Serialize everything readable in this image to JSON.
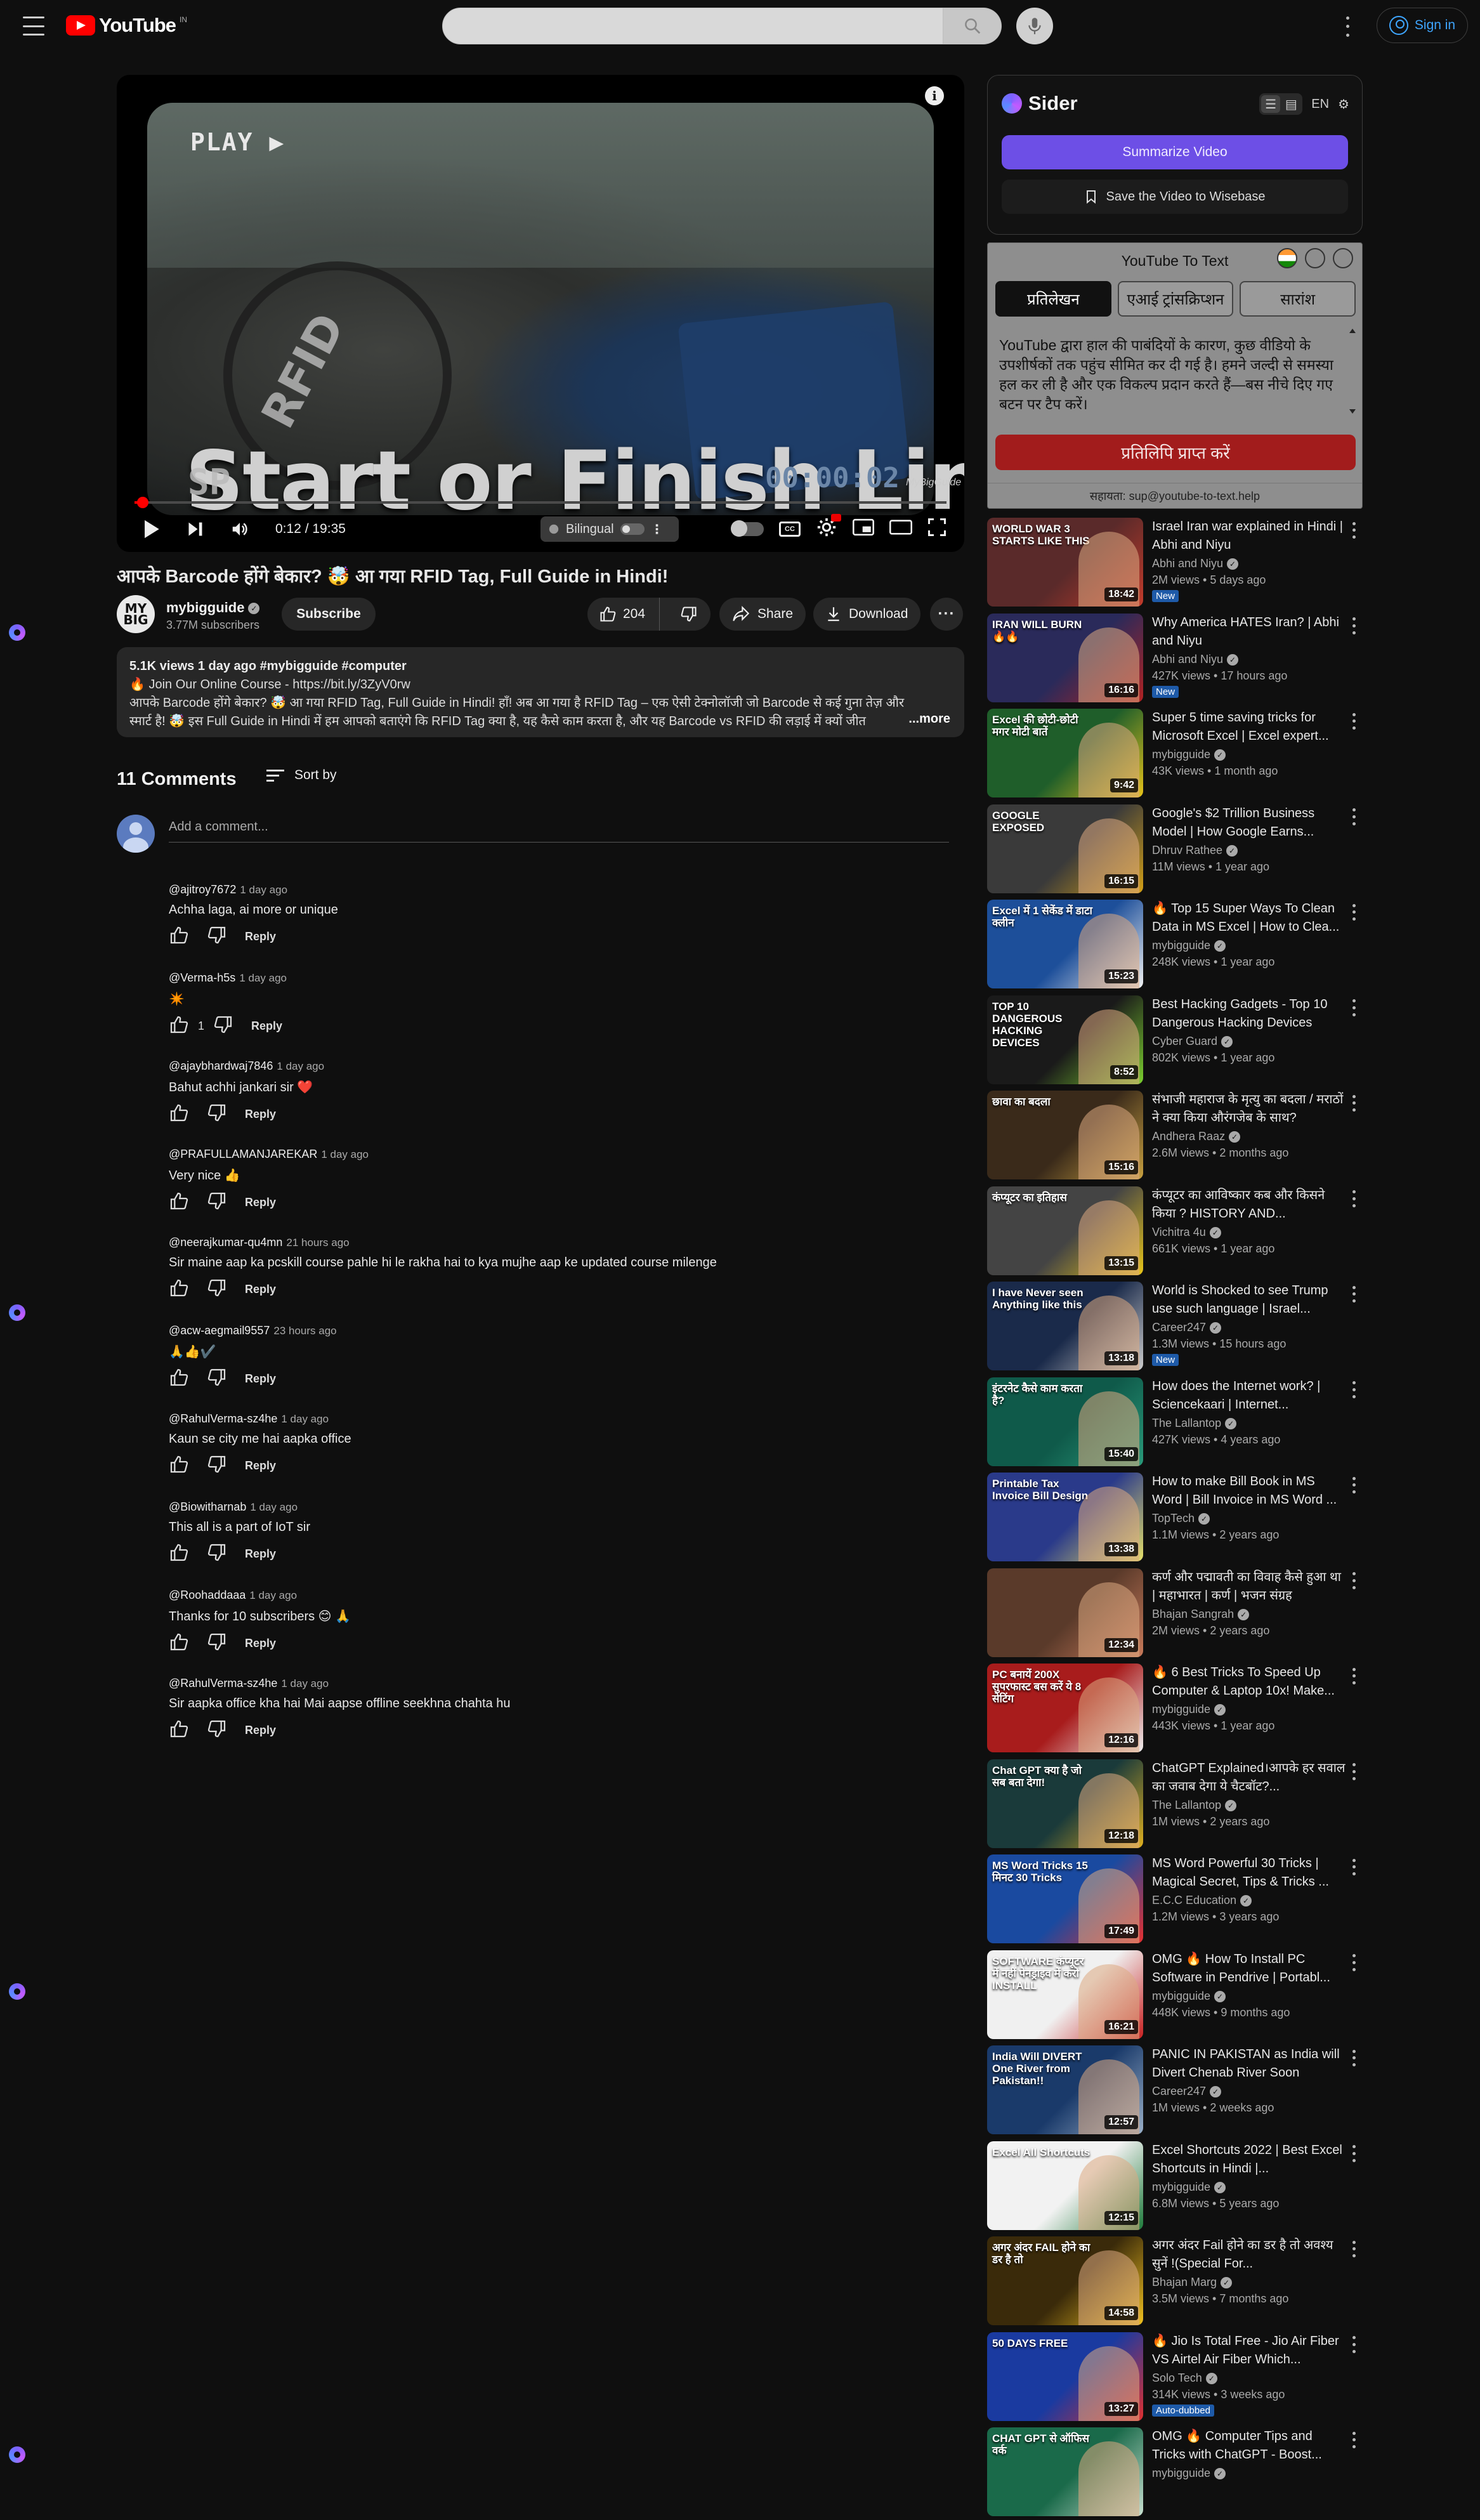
{
  "header": {
    "logo_text": "YouTube",
    "logo_country": "IN",
    "search_placeholder": "",
    "signin_label": "Sign in"
  },
  "player": {
    "overlay_play": "PLAY ▶",
    "overlay_sp": "SP",
    "overlay_title": "Start or Finish Line",
    "overlay_timer": "00:00:02",
    "overlay_watermark": "MyBigGuide",
    "frame_brand": "RFID",
    "current_time": "0:12",
    "duration": "19:35",
    "time_display": "0:12 / 19:35",
    "progress_fraction": 0.0102,
    "bilingual_label": "Bilingual",
    "cc_label": "CC"
  },
  "video": {
    "title": "आपके Barcode होंगे बेकार? 🤯 आ गया RFID Tag, Full Guide in Hindi!",
    "channel_avatar_text": "MY BIG",
    "channel_name": "mybigguide",
    "subscribers": "3.77M subscribers",
    "subscribe_label": "Subscribe",
    "likes": "204",
    "share_label": "Share",
    "download_label": "Download"
  },
  "description": {
    "meta": "5.1K views  1 day ago  #mybigguide #computer",
    "line1": "🔥 Join Our Online Course - https://bit.ly/3ZyV0rw",
    "line2": "आपके Barcode होंगे बेकार? 🤯 आ गया RFID Tag, Full Guide in Hindi! हाँ! अब आ गया है RFID Tag – एक ऐसी टेक्नोलॉजी जो Barcode से कई गुना तेज़ और",
    "line3": "स्मार्ट है! 🤯 इस Full Guide in Hindi में हम आपको बताएंगे कि RFID Tag क्या है, यह कैसे काम करता है, और यह Barcode vs RFID की लड़ाई में क्यों जीत",
    "more_label": "...more"
  },
  "comments_section": {
    "count_label": "11 Comments",
    "sort_label": "Sort by",
    "add_placeholder": "Add a comment...",
    "reply_label": "Reply",
    "items": [
      {
        "author": "@ajitroy7672",
        "time": "1 day ago",
        "text": "Achha laga, ai more or unique",
        "likes": ""
      },
      {
        "author": "@Verma-h5s",
        "time": "1 day ago",
        "text": "✴️",
        "likes": "1"
      },
      {
        "author": "@ajaybhardwaj7846",
        "time": "1 day ago",
        "text": "Bahut achhi jankari sir ❤️",
        "likes": ""
      },
      {
        "author": "@PRAFULLAMANJAREKAR",
        "time": "1 day ago",
        "text": "Very nice 👍",
        "likes": ""
      },
      {
        "author": "@neerajkumar-qu4mn",
        "time": "21 hours ago",
        "text": "Sir maine aap ka pcskill course pahle hi le rakha hai to kya mujhe aap ke updated course milenge",
        "likes": ""
      },
      {
        "author": "@acw-aegmail9557",
        "time": "23 hours ago",
        "text": "🙏👍✔️",
        "likes": ""
      },
      {
        "author": "@RahulVerma-sz4he",
        "time": "1 day ago",
        "text": "Kaun se city me hai aapka office",
        "likes": ""
      },
      {
        "author": "@Biowitharnab",
        "time": "1 day ago",
        "text": "This all is a part of IoT sir",
        "likes": ""
      },
      {
        "author": "@Roohaddaaa",
        "time": "1 day ago",
        "text": "Thanks for 10 subscribers 😊 🙏",
        "likes": ""
      },
      {
        "author": "@RahulVerma-sz4he",
        "time": "1 day ago",
        "text": "Sir aapka office kha hai Mai aapse offline seekhna chahta hu",
        "likes": ""
      }
    ]
  },
  "sider": {
    "brand": "Sider",
    "lang": "EN",
    "summarize_label": "Summarize Video",
    "wisebase_label": "Save the Video to Wisebase"
  },
  "ytt": {
    "title": "YouTube To Text",
    "tabs": [
      "प्रतिलेखन",
      "एआई ट्रांसक्रिप्शन",
      "सारांश"
    ],
    "message": "YouTube द्वारा हाल की पाबंदियों के कारण, कुछ वीडियो के उपशीर्षकों तक पहुंच सीमित कर दी गई है। हमने जल्दी से समस्या हल कर ली है और एक विकल्प प्रदान करते हैं—बस नीचे दिए गए बटन पर टैप करें।",
    "get_button": "प्रतिलिपि प्राप्त करें",
    "help": "सहायता: sup@youtube-to-text.help"
  },
  "recommendations": [
    {
      "title": "Israel Iran war explained in Hindi | Abhi and Niyu",
      "channel": "Abhi and Niyu",
      "meta": "2M views  •  5 days ago",
      "duration": "18:42",
      "badge": "New",
      "thumb_text": "WORLD WAR 3 STARTS LIKE THIS",
      "bg": "#5a2a2a",
      "bg2": "#c23b2b"
    },
    {
      "title": "Why America HATES Iran? | Abhi and Niyu",
      "channel": "Abhi and Niyu",
      "meta": "427K views  •  17 hours ago",
      "duration": "16:16",
      "badge": "New",
      "thumb_text": "IRAN WILL BURN 🔥🔥",
      "bg": "#2a2a5a",
      "bg2": "#b22222"
    },
    {
      "title": "Super 5 time saving tricks for Microsoft Excel | Excel expert...",
      "channel": "mybigguide",
      "meta": "43K views  •  1 month ago",
      "duration": "9:42",
      "badge": "",
      "thumb_text": "Excel की छोटी-छोटी मगर मोटी बातें",
      "bg": "#1f5e2a",
      "bg2": "#e6c21a"
    },
    {
      "title": "Google's $2 Trillion Business Model | How Google Earns...",
      "channel": "Dhruv Rathee",
      "meta": "11M views  •  1 year ago",
      "duration": "16:15",
      "badge": "",
      "thumb_text": "GOOGLE EXPOSED",
      "bg": "#3a3a3a",
      "bg2": "#d4a017"
    },
    {
      "title": "🔥 Top 15 Super Ways To Clean Data in MS Excel | How to Clea...",
      "channel": "mybigguide",
      "meta": "248K views  •  1 year ago",
      "duration": "15:23",
      "badge": "",
      "thumb_text": "Excel में 1 सेकेंड में डाटा क्लीन",
      "bg": "#1d4f9a",
      "bg2": "#f2f2f2"
    },
    {
      "title": "Best Hacking Gadgets - Top 10 Dangerous Hacking Devices",
      "channel": "Cyber Guard",
      "meta": "802K views  •  1 year ago",
      "duration": "8:52",
      "badge": "",
      "thumb_text": "TOP 10 DANGEROUS HACKING DEVICES",
      "bg": "#1a1a1a",
      "bg2": "#7ccf2f"
    },
    {
      "title": "संभाजी महाराज के मृत्यु का बदला / मराठों ने क्या किया औरंगजेब के साथ?",
      "channel": "Andhera Raaz",
      "meta": "2.6M views  •  2 months ago",
      "duration": "15:16",
      "badge": "",
      "thumb_text": "छावा का बदला",
      "bg": "#3a2a1a",
      "bg2": "#c8a040"
    },
    {
      "title": "कंप्यूटर का आविष्कार कब और किसने किया ? HISTORY AND...",
      "channel": "Vichitra 4u",
      "meta": "661K views  •  1 year ago",
      "duration": "13:15",
      "badge": "",
      "thumb_text": "कंप्यूटर का इतिहास",
      "bg": "#444444",
      "bg2": "#e8c51a"
    },
    {
      "title": "World is Shocked to see Trump use such language | Israel...",
      "channel": "Career247",
      "meta": "1.3M views  •  15 hours ago",
      "duration": "13:18",
      "badge": "New",
      "thumb_text": "I have Never seen Anything like this",
      "bg": "#1a2a4a",
      "bg2": "#cccccc"
    },
    {
      "title": "How does the Internet work? | Sciencekaari | Internet...",
      "channel": "The Lallantop",
      "meta": "427K views  •  4 years ago",
      "duration": "15:40",
      "badge": "",
      "thumb_text": "इंटरनेट कैसे काम करता है?",
      "bg": "#0f5a4a",
      "bg2": "#2a9a7a"
    },
    {
      "title": "How to make Bill Book in MS Word | Bill Invoice in MS Word ...",
      "channel": "TopTech",
      "meta": "1.1M views  •  2 years ago",
      "duration": "13:38",
      "badge": "",
      "thumb_text": "Printable Tax Invoice Bill Design",
      "bg": "#2a3a8a",
      "bg2": "#e6e06a"
    },
    {
      "title": "कर्ण और पद्मावती का विवाह कैसे हुआ था | महाभारत | कर्ण | भजन संग्रह",
      "channel": "Bhajan Sangrah",
      "meta": "2M views  •  2 years ago",
      "duration": "12:34",
      "badge": "",
      "thumb_text": "",
      "bg": "#5a3a2a",
      "bg2": "#c87a5a"
    },
    {
      "title": "🔥 6 Best Tricks To Speed Up Computer & Laptop 10x! Make...",
      "channel": "mybigguide",
      "meta": "443K views  •  1 year ago",
      "duration": "12:16",
      "badge": "",
      "thumb_text": "PC बनायें 200X सुपरफास्ट बस करें ये 8 सेटिंग",
      "bg": "#a81c1c",
      "bg2": "#f0f0f0"
    },
    {
      "title": "ChatGPT Explained।आपके हर सवाल का जवाब देगा ये चैटबॉट?...",
      "channel": "The Lallantop",
      "meta": "1M views  •  2 years ago",
      "duration": "12:18",
      "badge": "",
      "thumb_text": "Chat GPT क्या है जो सब बता देगा!",
      "bg": "#1a3a3a",
      "bg2": "#e0b020"
    },
    {
      "title": "MS Word Powerful 30 Tricks | Magical Secret, Tips & Tricks ...",
      "channel": "E.C.C Education",
      "meta": "1.2M views  •  3 years ago",
      "duration": "17:49",
      "badge": "",
      "thumb_text": "MS Word Tricks 15 मिनट 30 Tricks",
      "bg": "#1a4aa0",
      "bg2": "#e63030"
    },
    {
      "title": "OMG 🔥 How To Install PC Software in Pendrive | Portabl...",
      "channel": "mybigguide",
      "meta": "448K views  •  9 months ago",
      "duration": "16:21",
      "badge": "",
      "thumb_text": "SOFTWARE कंप्यूटर में नहीं पेनड्राइव में करो INSTALL",
      "bg": "#f0f0f0",
      "bg2": "#c82020"
    },
    {
      "title": "PANIC IN PAKISTAN as India will Divert Chenab River Soon",
      "channel": "Career247",
      "meta": "1M views  •  2 weeks ago",
      "duration": "12:57",
      "badge": "",
      "thumb_text": "India Will DIVERT One River from Pakistan!!",
      "bg": "#1a3a6a",
      "bg2": "#9ab0c8"
    },
    {
      "title": "Excel Shortcuts 2022 | Best Excel Shortcuts in Hindi |...",
      "channel": "mybigguide",
      "meta": "6.8M views  •  5 years ago",
      "duration": "12:15",
      "badge": "",
      "thumb_text": "Excel All Shortcuts",
      "bg": "#f2f2f2",
      "bg2": "#1e7a3a"
    },
    {
      "title": "अगर अंदर Fail होने का डर है तो अवश्य सुनें !(Special For...",
      "channel": "Bhajan Marg",
      "meta": "3.5M views  •  7 months ago",
      "duration": "14:58",
      "badge": "",
      "thumb_text": "अगर अंदर FAIL होने का डर है तो",
      "bg": "#3a2a0a",
      "bg2": "#f0c020"
    },
    {
      "title": "🔥 Jio Is Total Free - Jio Air Fiber VS Airtel Air Fiber Which...",
      "channel": "Solo Tech",
      "meta": "314K views  •  3 weeks ago",
      "duration": "13:27",
      "badge": "Auto-dubbed",
      "thumb_text": "50 DAYS FREE",
      "bg": "#1a3aa0",
      "bg2": "#e03030"
    },
    {
      "title": "OMG 🔥 Computer Tips and Tricks with ChatGPT - Boost...",
      "channel": "mybigguide",
      "meta": "",
      "duration": "",
      "badge": "",
      "thumb_text": "CHAT GPT से ऑफिस वर्क",
      "bg": "#1a6a4a",
      "bg2": "#c8e0d0"
    }
  ]
}
